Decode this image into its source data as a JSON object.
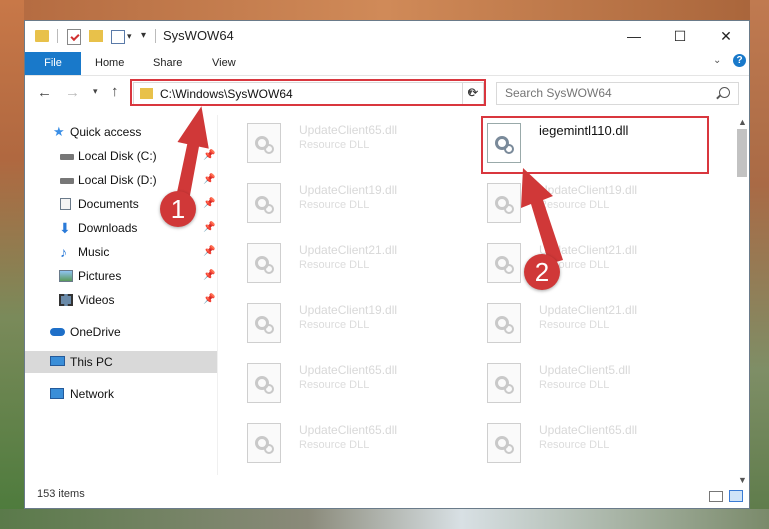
{
  "window": {
    "title": "SysWOW64"
  },
  "controls": {
    "minimize": "—",
    "maximize": "☐",
    "close": "✕"
  },
  "ribbon": {
    "tabs": [
      "File",
      "Home",
      "Share",
      "View"
    ]
  },
  "address": {
    "path": "C:\\Windows\\SysWOW64"
  },
  "search": {
    "placeholder": "Search SysWOW64"
  },
  "sidebar": {
    "items": [
      {
        "label": "Quick access",
        "icon": "star-icon"
      },
      {
        "label": "Local Disk (C:)",
        "icon": "drive-icon",
        "pinned": true
      },
      {
        "label": "Local Disk (D:)",
        "icon": "drive-icon",
        "pinned": true
      },
      {
        "label": "Documents",
        "icon": "documents-icon",
        "pinned": true
      },
      {
        "label": "Downloads",
        "icon": "downloads-icon",
        "pinned": true
      },
      {
        "label": "Music",
        "icon": "music-icon",
        "pinned": true
      },
      {
        "label": "Pictures",
        "icon": "pictures-icon",
        "pinned": true
      },
      {
        "label": "Videos",
        "icon": "videos-icon",
        "pinned": true
      },
      {
        "label": "OneDrive",
        "icon": "cloud-icon"
      },
      {
        "label": "This PC",
        "icon": "computer-icon",
        "selected": true
      },
      {
        "label": "Network",
        "icon": "network-icon"
      }
    ]
  },
  "files": [
    {
      "name": "UpdateClient65.dll",
      "type": "Resource DLL"
    },
    {
      "name": "iegemintl110.dll",
      "type": "",
      "highlighted": true
    },
    {
      "name": "UpdateClient19.dll",
      "type": "Resource DLL"
    },
    {
      "name": "UpdateClient19.dll",
      "type": "Resource DLL"
    },
    {
      "name": "UpdateClient21.dll",
      "type": "Resource DLL"
    },
    {
      "name": "UpdateClient21.dll",
      "type": "Resource DLL"
    },
    {
      "name": "UpdateClient19.dll",
      "type": "Resource DLL"
    },
    {
      "name": "UpdateClient21.dll",
      "type": "Resource DLL"
    },
    {
      "name": "UpdateClient65.dll",
      "type": "Resource DLL"
    },
    {
      "name": "UpdateClient5.dll",
      "type": "Resource DLL"
    },
    {
      "name": "UpdateClient65.dll",
      "type": "Resource DLL"
    },
    {
      "name": "UpdateClient65.dll",
      "type": "Resource DLL"
    }
  ],
  "status": {
    "item_count": "153 items"
  },
  "annotations": {
    "step1": "1",
    "step2": "2"
  },
  "colors": {
    "accent": "#1979ca",
    "highlight": "#d9363e"
  }
}
